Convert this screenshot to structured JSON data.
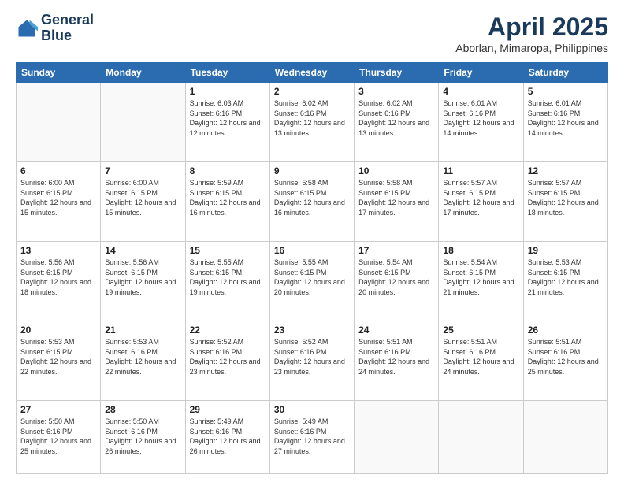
{
  "header": {
    "logo_line1": "General",
    "logo_line2": "Blue",
    "title": "April 2025",
    "subtitle": "Aborlan, Mimaropa, Philippines"
  },
  "days_of_week": [
    "Sunday",
    "Monday",
    "Tuesday",
    "Wednesday",
    "Thursday",
    "Friday",
    "Saturday"
  ],
  "weeks": [
    [
      {
        "day": "",
        "sunrise": "",
        "sunset": "",
        "daylight": ""
      },
      {
        "day": "",
        "sunrise": "",
        "sunset": "",
        "daylight": ""
      },
      {
        "day": "1",
        "sunrise": "Sunrise: 6:03 AM",
        "sunset": "Sunset: 6:16 PM",
        "daylight": "Daylight: 12 hours and 12 minutes."
      },
      {
        "day": "2",
        "sunrise": "Sunrise: 6:02 AM",
        "sunset": "Sunset: 6:16 PM",
        "daylight": "Daylight: 12 hours and 13 minutes."
      },
      {
        "day": "3",
        "sunrise": "Sunrise: 6:02 AM",
        "sunset": "Sunset: 6:16 PM",
        "daylight": "Daylight: 12 hours and 13 minutes."
      },
      {
        "day": "4",
        "sunrise": "Sunrise: 6:01 AM",
        "sunset": "Sunset: 6:16 PM",
        "daylight": "Daylight: 12 hours and 14 minutes."
      },
      {
        "day": "5",
        "sunrise": "Sunrise: 6:01 AM",
        "sunset": "Sunset: 6:16 PM",
        "daylight": "Daylight: 12 hours and 14 minutes."
      }
    ],
    [
      {
        "day": "6",
        "sunrise": "Sunrise: 6:00 AM",
        "sunset": "Sunset: 6:15 PM",
        "daylight": "Daylight: 12 hours and 15 minutes."
      },
      {
        "day": "7",
        "sunrise": "Sunrise: 6:00 AM",
        "sunset": "Sunset: 6:15 PM",
        "daylight": "Daylight: 12 hours and 15 minutes."
      },
      {
        "day": "8",
        "sunrise": "Sunrise: 5:59 AM",
        "sunset": "Sunset: 6:15 PM",
        "daylight": "Daylight: 12 hours and 16 minutes."
      },
      {
        "day": "9",
        "sunrise": "Sunrise: 5:58 AM",
        "sunset": "Sunset: 6:15 PM",
        "daylight": "Daylight: 12 hours and 16 minutes."
      },
      {
        "day": "10",
        "sunrise": "Sunrise: 5:58 AM",
        "sunset": "Sunset: 6:15 PM",
        "daylight": "Daylight: 12 hours and 17 minutes."
      },
      {
        "day": "11",
        "sunrise": "Sunrise: 5:57 AM",
        "sunset": "Sunset: 6:15 PM",
        "daylight": "Daylight: 12 hours and 17 minutes."
      },
      {
        "day": "12",
        "sunrise": "Sunrise: 5:57 AM",
        "sunset": "Sunset: 6:15 PM",
        "daylight": "Daylight: 12 hours and 18 minutes."
      }
    ],
    [
      {
        "day": "13",
        "sunrise": "Sunrise: 5:56 AM",
        "sunset": "Sunset: 6:15 PM",
        "daylight": "Daylight: 12 hours and 18 minutes."
      },
      {
        "day": "14",
        "sunrise": "Sunrise: 5:56 AM",
        "sunset": "Sunset: 6:15 PM",
        "daylight": "Daylight: 12 hours and 19 minutes."
      },
      {
        "day": "15",
        "sunrise": "Sunrise: 5:55 AM",
        "sunset": "Sunset: 6:15 PM",
        "daylight": "Daylight: 12 hours and 19 minutes."
      },
      {
        "day": "16",
        "sunrise": "Sunrise: 5:55 AM",
        "sunset": "Sunset: 6:15 PM",
        "daylight": "Daylight: 12 hours and 20 minutes."
      },
      {
        "day": "17",
        "sunrise": "Sunrise: 5:54 AM",
        "sunset": "Sunset: 6:15 PM",
        "daylight": "Daylight: 12 hours and 20 minutes."
      },
      {
        "day": "18",
        "sunrise": "Sunrise: 5:54 AM",
        "sunset": "Sunset: 6:15 PM",
        "daylight": "Daylight: 12 hours and 21 minutes."
      },
      {
        "day": "19",
        "sunrise": "Sunrise: 5:53 AM",
        "sunset": "Sunset: 6:15 PM",
        "daylight": "Daylight: 12 hours and 21 minutes."
      }
    ],
    [
      {
        "day": "20",
        "sunrise": "Sunrise: 5:53 AM",
        "sunset": "Sunset: 6:15 PM",
        "daylight": "Daylight: 12 hours and 22 minutes."
      },
      {
        "day": "21",
        "sunrise": "Sunrise: 5:53 AM",
        "sunset": "Sunset: 6:16 PM",
        "daylight": "Daylight: 12 hours and 22 minutes."
      },
      {
        "day": "22",
        "sunrise": "Sunrise: 5:52 AM",
        "sunset": "Sunset: 6:16 PM",
        "daylight": "Daylight: 12 hours and 23 minutes."
      },
      {
        "day": "23",
        "sunrise": "Sunrise: 5:52 AM",
        "sunset": "Sunset: 6:16 PM",
        "daylight": "Daylight: 12 hours and 23 minutes."
      },
      {
        "day": "24",
        "sunrise": "Sunrise: 5:51 AM",
        "sunset": "Sunset: 6:16 PM",
        "daylight": "Daylight: 12 hours and 24 minutes."
      },
      {
        "day": "25",
        "sunrise": "Sunrise: 5:51 AM",
        "sunset": "Sunset: 6:16 PM",
        "daylight": "Daylight: 12 hours and 24 minutes."
      },
      {
        "day": "26",
        "sunrise": "Sunrise: 5:51 AM",
        "sunset": "Sunset: 6:16 PM",
        "daylight": "Daylight: 12 hours and 25 minutes."
      }
    ],
    [
      {
        "day": "27",
        "sunrise": "Sunrise: 5:50 AM",
        "sunset": "Sunset: 6:16 PM",
        "daylight": "Daylight: 12 hours and 25 minutes."
      },
      {
        "day": "28",
        "sunrise": "Sunrise: 5:50 AM",
        "sunset": "Sunset: 6:16 PM",
        "daylight": "Daylight: 12 hours and 26 minutes."
      },
      {
        "day": "29",
        "sunrise": "Sunrise: 5:49 AM",
        "sunset": "Sunset: 6:16 PM",
        "daylight": "Daylight: 12 hours and 26 minutes."
      },
      {
        "day": "30",
        "sunrise": "Sunrise: 5:49 AM",
        "sunset": "Sunset: 6:16 PM",
        "daylight": "Daylight: 12 hours and 27 minutes."
      },
      {
        "day": "",
        "sunrise": "",
        "sunset": "",
        "daylight": ""
      },
      {
        "day": "",
        "sunrise": "",
        "sunset": "",
        "daylight": ""
      },
      {
        "day": "",
        "sunrise": "",
        "sunset": "",
        "daylight": ""
      }
    ]
  ]
}
